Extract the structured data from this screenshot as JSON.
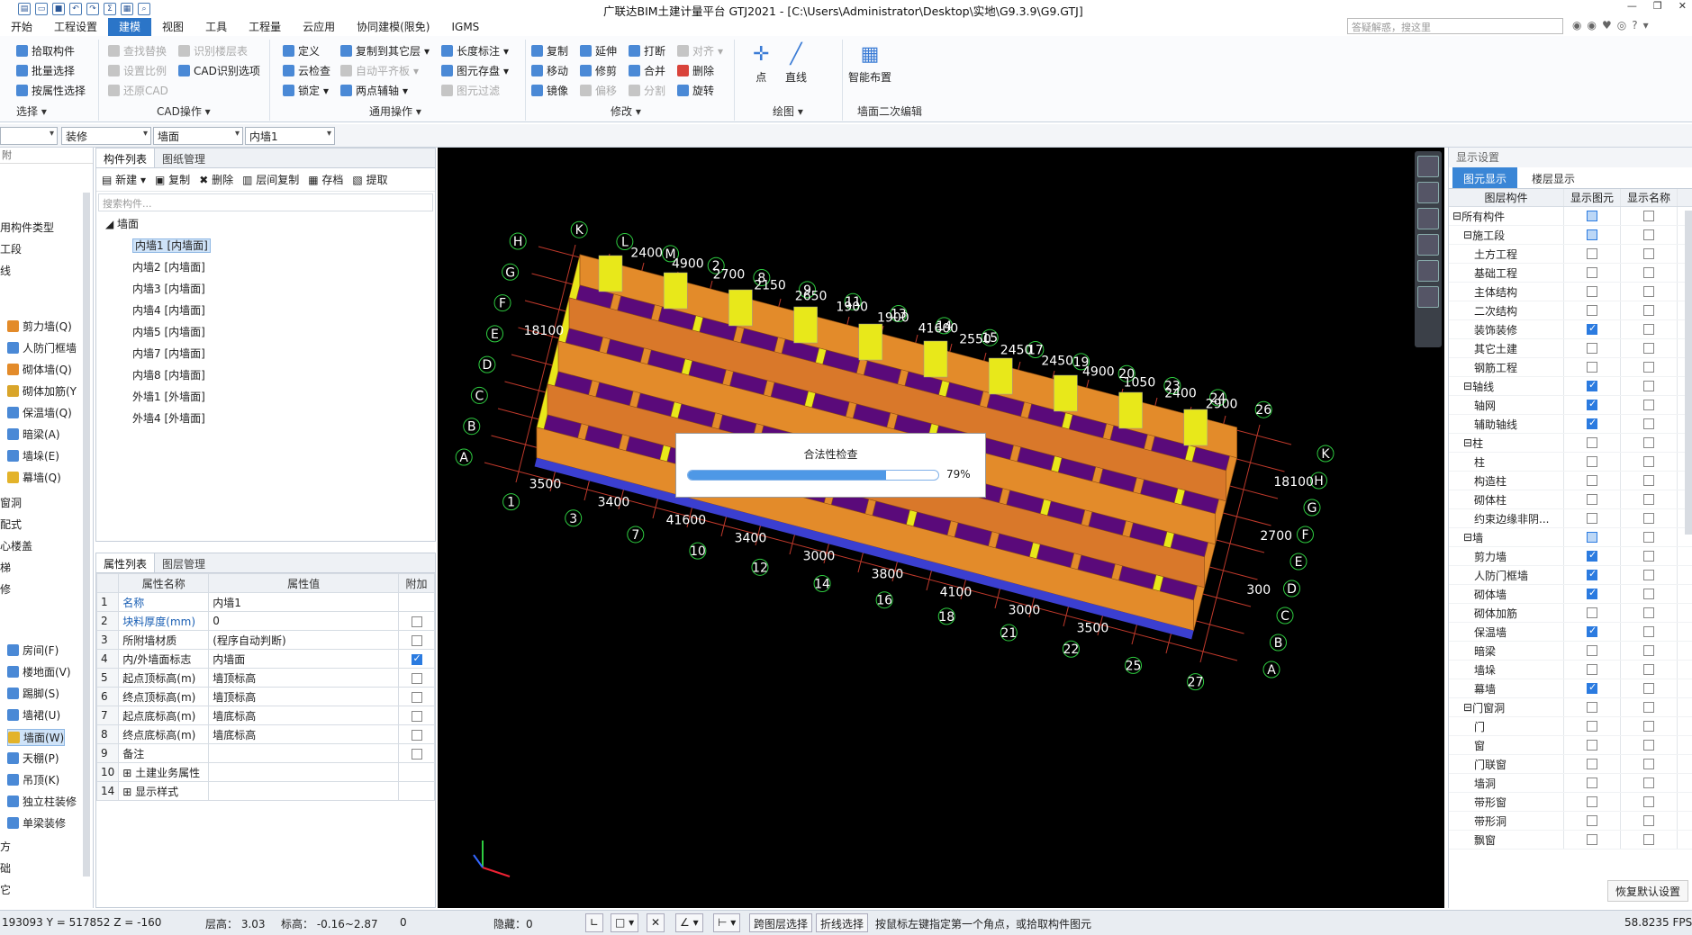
{
  "app": {
    "title": "广联达BIM土建计量平台 GTJ2021 - [C:\\Users\\Administrator\\Desktop\\实地\\G9.3.9\\G9.GTJ]"
  },
  "menu": [
    "开始",
    "工程设置",
    "建模",
    "视图",
    "工具",
    "工程量",
    "云应用",
    "协同建模(限免)",
    "IGMS"
  ],
  "menu_active": "建模",
  "top_search": {
    "placeholder": "答疑解惑，搜这里"
  },
  "ribbon": {
    "select": {
      "items": [
        "拾取构件",
        "批量选择",
        "按属性选择"
      ],
      "label": "选择"
    },
    "cad": {
      "items": [
        "查找替换",
        "识别楼层表",
        "设置比例",
        "CAD识别选项",
        "还原CAD"
      ],
      "label": "CAD操作"
    },
    "general": {
      "items": [
        "定义",
        "复制到其它层",
        "长度标注",
        "云检查",
        "自动平齐板",
        "图元存盘",
        "锁定",
        "两点辅轴",
        "图元过滤"
      ],
      "label": "通用操作"
    },
    "modify": {
      "items": [
        "复制",
        "延伸",
        "打断",
        "对齐",
        "移动",
        "修剪",
        "合并",
        "删除",
        "镜像",
        "偏移",
        "分割",
        "旋转"
      ],
      "label": "修改"
    },
    "draw": {
      "items": [
        "点",
        "直线"
      ],
      "label": "绘图"
    },
    "wall_edit": {
      "items": [
        "智能布置"
      ],
      "label": "墙面二次编辑"
    }
  },
  "combos": [
    "",
    "装修",
    "墙面",
    "内墙1"
  ],
  "left_nav": {
    "top_items": [
      "用构件类型",
      "工段",
      "线"
    ],
    "wall_items": [
      "剪力墙(Q)",
      "人防门框墙",
      "砌体墙(Q)",
      "砌体加筋(Y",
      "保温墙(Q)",
      "暗梁(A)",
      "墙垛(E)",
      "幕墙(Q)"
    ],
    "mid_items": [
      "窗洞",
      "配式",
      "心楼盖",
      "梯",
      "修"
    ],
    "deco_items": [
      "房间(F)",
      "楼地面(V)",
      "踢脚(S)",
      "墙裙(U)",
      "墙面(W)",
      "天棚(P)",
      "吊顶(K)",
      "独立柱装修",
      "单梁装修"
    ],
    "bottom_items": [
      "方",
      "础",
      "它"
    ],
    "selected": "墙面(W)"
  },
  "component_panel": {
    "tabs": [
      "构件列表",
      "图纸管理"
    ],
    "toolbar": [
      "新建",
      "复制",
      "删除",
      "层间复制",
      "存档",
      "提取"
    ],
    "search_placeholder": "搜索构件...",
    "root": "墙面",
    "items": [
      "内墙1 [内墙面]",
      "内墙2 [内墙面]",
      "内墙3 [内墙面]",
      "内墙4 [内墙面]",
      "内墙5 [内墙面]",
      "内墙7 [内墙面]",
      "内墙8 [内墙面]",
      "外墙1 [外墙面]",
      "外墙4 [外墙面]"
    ],
    "selected_index": 0
  },
  "property_panel": {
    "tabs": [
      "属性列表",
      "图层管理"
    ],
    "headers": [
      "属性名称",
      "属性值",
      "附加"
    ],
    "rows": [
      {
        "no": "1",
        "name": "名称",
        "value": "内墙1",
        "check": null,
        "blue": true
      },
      {
        "no": "2",
        "name": "块料厚度(mm)",
        "value": "0",
        "check": false,
        "blue": true
      },
      {
        "no": "3",
        "name": "所附墙材质",
        "value": "(程序自动判断)",
        "check": false,
        "blue": false
      },
      {
        "no": "4",
        "name": "内/外墙面标志",
        "value": "内墙面",
        "check": true,
        "blue": false
      },
      {
        "no": "5",
        "name": "起点顶标高(m)",
        "value": "墙顶标高",
        "check": false,
        "blue": false
      },
      {
        "no": "6",
        "name": "终点顶标高(m)",
        "value": "墙顶标高",
        "check": false,
        "blue": false
      },
      {
        "no": "7",
        "name": "起点底标高(m)",
        "value": "墙底标高",
        "check": false,
        "blue": false
      },
      {
        "no": "8",
        "name": "终点底标高(m)",
        "value": "墙底标高",
        "check": false,
        "blue": false
      },
      {
        "no": "9",
        "name": "备注",
        "value": "",
        "check": false,
        "blue": false
      },
      {
        "no": "10",
        "name": "土建业务属性",
        "value": "",
        "check": null,
        "blue": false,
        "expand": true
      },
      {
        "no": "14",
        "name": "显示样式",
        "value": "",
        "check": null,
        "blue": false,
        "expand": true
      }
    ]
  },
  "progress_dialog": {
    "title": "合法性检查",
    "percent_label": "79%",
    "fraction": 0.79
  },
  "axis_labels": [
    "K",
    "L",
    "M",
    "2",
    "8",
    "9",
    "11",
    "13",
    "14",
    "15",
    "17",
    "19",
    "20",
    "23",
    "24",
    "26",
    "H",
    "G",
    "F",
    "E",
    "D",
    "C",
    "B",
    "A",
    "1",
    "3",
    "7",
    "10",
    "12",
    "14",
    "16",
    "18",
    "21",
    "22",
    "25",
    "27",
    "K",
    "H",
    "G",
    "F",
    "E",
    "D",
    "C",
    "B",
    "A"
  ],
  "dim_labels": [
    "2400",
    "4900",
    "2700",
    "2150",
    "2650",
    "1900",
    "1900",
    "41600",
    "2550",
    "2450",
    "2450",
    "4900",
    "1050",
    "2400",
    "2900",
    "18100",
    "3500",
    "3400",
    "41600",
    "3400",
    "3000",
    "3800",
    "4100",
    "3000",
    "3500",
    "18100",
    "2700",
    "300"
  ],
  "display_panel": {
    "title": "显示设置",
    "tabs": [
      "图元显示",
      "楼层显示"
    ],
    "headers": [
      "图层构件",
      "显示图元",
      "显示名称"
    ],
    "rows": [
      {
        "name": "所有构件",
        "level": 0,
        "toggle": "−",
        "show": "part",
        "label": false
      },
      {
        "name": "施工段",
        "level": 1,
        "toggle": "−",
        "show": "part",
        "label": false
      },
      {
        "name": "土方工程",
        "level": 2,
        "show": false,
        "label": false
      },
      {
        "name": "基础工程",
        "level": 2,
        "show": false,
        "label": false
      },
      {
        "name": "主体结构",
        "level": 2,
        "show": false,
        "label": false
      },
      {
        "name": "二次结构",
        "level": 2,
        "show": false,
        "label": false
      },
      {
        "name": "装饰装修",
        "level": 2,
        "show": true,
        "label": false
      },
      {
        "name": "其它土建",
        "level": 2,
        "show": false,
        "label": false
      },
      {
        "name": "钢筋工程",
        "level": 2,
        "show": false,
        "label": false
      },
      {
        "name": "轴线",
        "level": 1,
        "toggle": "−",
        "show": true,
        "label": false
      },
      {
        "name": "轴网",
        "level": 2,
        "show": true,
        "label": false
      },
      {
        "name": "辅助轴线",
        "level": 2,
        "show": true,
        "label": false
      },
      {
        "name": "柱",
        "level": 1,
        "toggle": "−",
        "show": false,
        "label": false
      },
      {
        "name": "柱",
        "level": 2,
        "show": false,
        "label": false
      },
      {
        "name": "构造柱",
        "level": 2,
        "show": false,
        "label": false
      },
      {
        "name": "砌体柱",
        "level": 2,
        "show": false,
        "label": false
      },
      {
        "name": "约束边缘非阴...",
        "level": 2,
        "show": false,
        "label": false
      },
      {
        "name": "墙",
        "level": 1,
        "toggle": "−",
        "show": "part",
        "label": false
      },
      {
        "name": "剪力墙",
        "level": 2,
        "show": true,
        "label": false
      },
      {
        "name": "人防门框墙",
        "level": 2,
        "show": true,
        "label": false
      },
      {
        "name": "砌体墙",
        "level": 2,
        "show": true,
        "label": false
      },
      {
        "name": "砌体加筋",
        "level": 2,
        "show": false,
        "label": false
      },
      {
        "name": "保温墙",
        "level": 2,
        "show": true,
        "label": false
      },
      {
        "name": "暗梁",
        "level": 2,
        "show": false,
        "label": false
      },
      {
        "name": "墙垛",
        "level": 2,
        "show": false,
        "label": false
      },
      {
        "name": "幕墙",
        "level": 2,
        "show": true,
        "label": false
      },
      {
        "name": "门窗洞",
        "level": 1,
        "toggle": "−",
        "show": false,
        "label": false
      },
      {
        "name": "门",
        "level": 2,
        "show": false,
        "label": false
      },
      {
        "name": "窗",
        "level": 2,
        "show": false,
        "label": false
      },
      {
        "name": "门联窗",
        "level": 2,
        "show": false,
        "label": false
      },
      {
        "name": "墙洞",
        "level": 2,
        "show": false,
        "label": false
      },
      {
        "name": "带形窗",
        "level": 2,
        "show": false,
        "label": false
      },
      {
        "name": "带形洞",
        "level": 2,
        "show": false,
        "label": false
      },
      {
        "name": "飘窗",
        "level": 2,
        "show": false,
        "label": false
      }
    ],
    "restore_button": "恢复默认设置"
  },
  "status": {
    "coords": "193093 Y = 517852 Z = -160",
    "floor_height": "层高：  3.03",
    "elevation": "标高：  -0.16~2.87",
    "zero": "0",
    "hidden": "隐藏：0",
    "btn_cross_layer": "跨图层选择",
    "btn_polyline": "折线选择",
    "hint": "按鼠标左键指定第一个角点，或拾取构件图元",
    "fps": "58.8235 FPS"
  },
  "colors": {
    "accent": "#2b75c8",
    "canvas": "#000000",
    "wall_orange": "#e38b2a",
    "floor_purple": "#5a0a7a",
    "wall_yellow": "#e8e81a",
    "axis_green": "#2ecc40"
  }
}
